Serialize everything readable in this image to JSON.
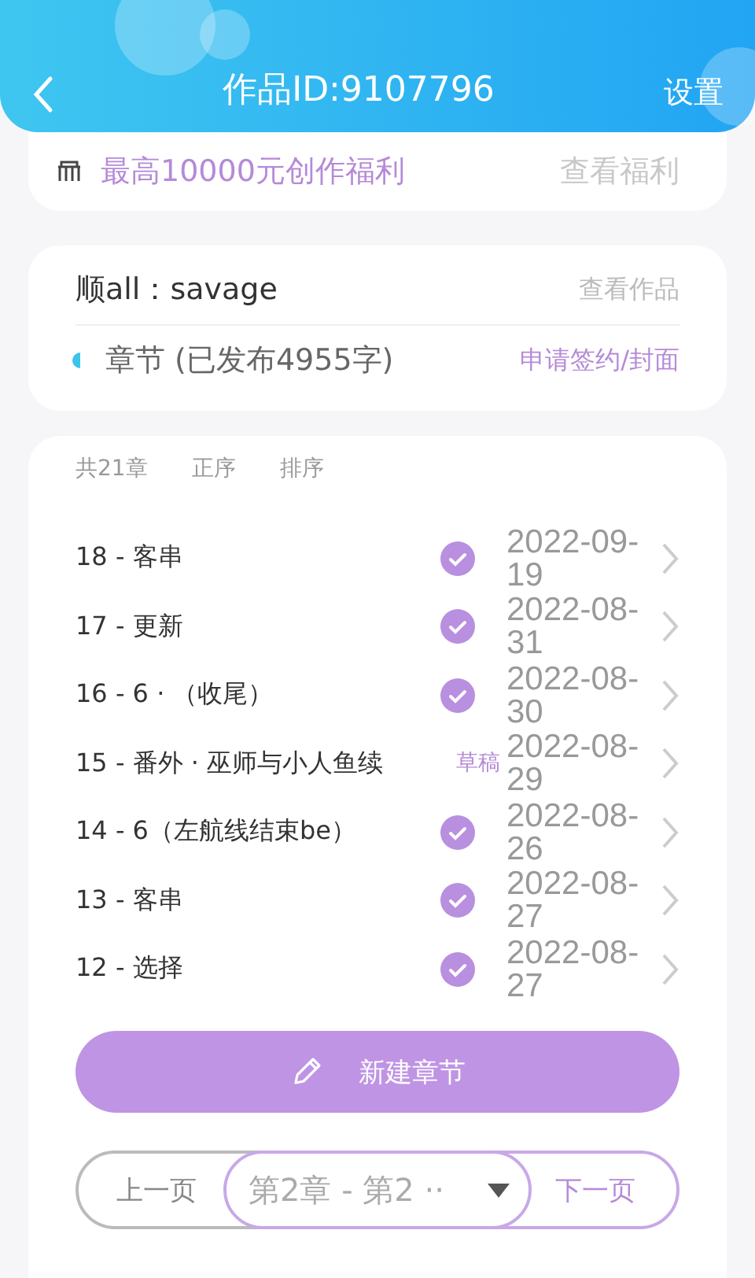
{
  "header": {
    "title": "作品ID:9107796",
    "settings": "设置"
  },
  "welfare": {
    "text": "最高10000元创作福利",
    "link": "查看福利"
  },
  "work": {
    "name": "顺all：savage",
    "view": "查看作品",
    "chapters_label": "章节 (已发布4955字)",
    "apply": "申请签约/封面"
  },
  "list": {
    "count": "共21章",
    "order": "正序",
    "sort": "排序",
    "rows": [
      {
        "title": "18 - 客串",
        "kind": "published",
        "date": "2022-09-19"
      },
      {
        "title": "17 - 更新",
        "kind": "published",
        "date": "2022-08-31"
      },
      {
        "title": "16 - 6 · （收尾）",
        "kind": "published",
        "date": "2022-08-30"
      },
      {
        "title": "15 - 番外 · 巫师与小人鱼续",
        "kind": "draft",
        "badge": "草稿",
        "date": "2022-08-29"
      },
      {
        "title": "14 - 6（左航线结束be）",
        "kind": "published",
        "date": "2022-08-26"
      },
      {
        "title": "13 - 客串",
        "kind": "published",
        "date": "2022-08-27"
      },
      {
        "title": "12 - 选择",
        "kind": "published",
        "date": "2022-08-27"
      }
    ],
    "new_button": "新建章节"
  },
  "pager": {
    "prev": "上一页",
    "select": "第2章 - 第2 ··",
    "next": "下一页"
  }
}
